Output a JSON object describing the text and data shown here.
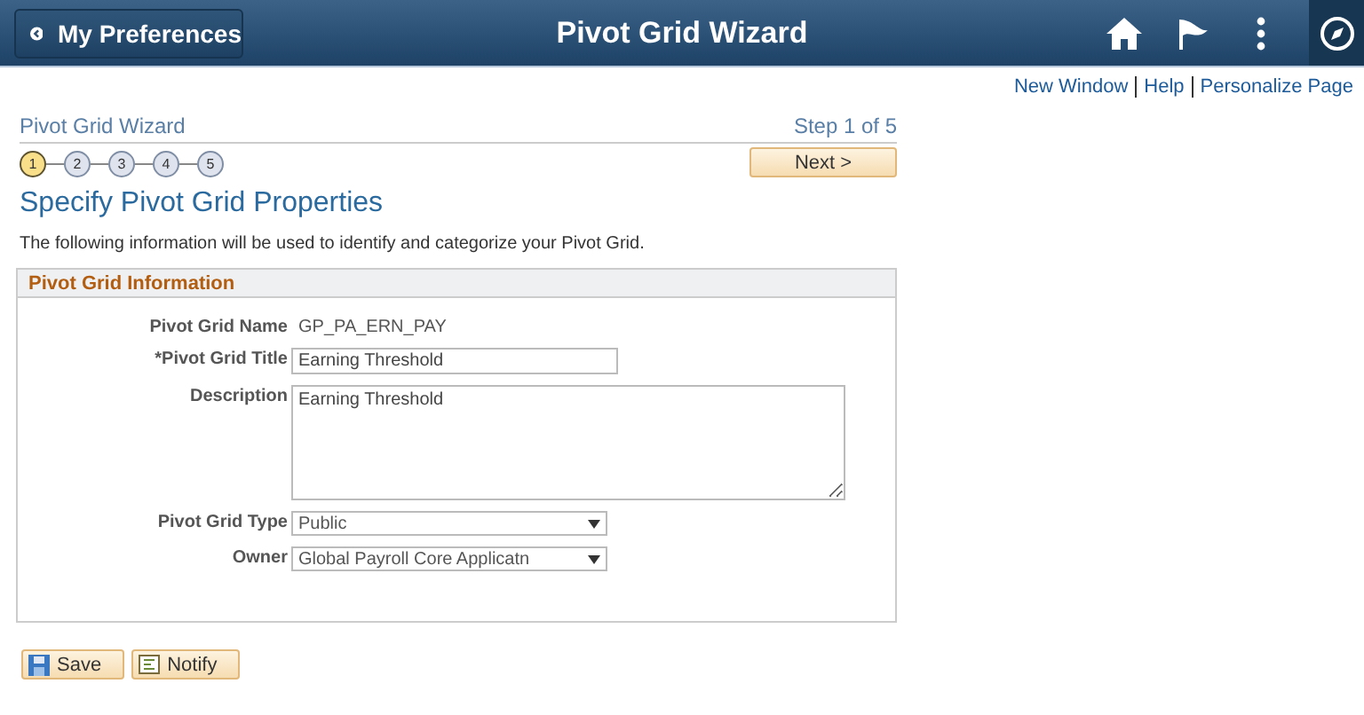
{
  "header": {
    "back_label": "My Preferences",
    "title": "Pivot Grid Wizard"
  },
  "links": [
    "New Window",
    "Help",
    "Personalize Page"
  ],
  "wizard": {
    "title": "Pivot Grid Wizard",
    "step_text": "Step 1 of 5",
    "next_label": "Next >",
    "steps": [
      {
        "label": "1",
        "selected": true
      },
      {
        "label": "2",
        "selected": false
      },
      {
        "label": "3",
        "selected": false
      },
      {
        "label": "4",
        "selected": false
      },
      {
        "label": "5",
        "selected": false
      }
    ]
  },
  "heading": "Specify Pivot Grid Properties",
  "intro": "The following information will be used to identify and categorize your Pivot Grid.",
  "group": {
    "title": "Pivot Grid Information",
    "fields": [
      {
        "kind": "display",
        "label": "Pivot Grid Name",
        "value": "GP_PA_ERN_PAY"
      },
      {
        "kind": "text",
        "label": "*Pivot Grid Title",
        "value": "Earning Threshold"
      },
      {
        "kind": "textarea",
        "label": "Description",
        "value": "Earning Threshold"
      },
      {
        "kind": "select",
        "label": "Pivot Grid Type",
        "value": "Public"
      },
      {
        "kind": "select",
        "label": "Owner",
        "value": "Global Payroll Core Applicatn"
      }
    ]
  },
  "buttons": [
    {
      "kind": "save",
      "label": "Save"
    },
    {
      "kind": "notify",
      "label": "Notify"
    }
  ]
}
